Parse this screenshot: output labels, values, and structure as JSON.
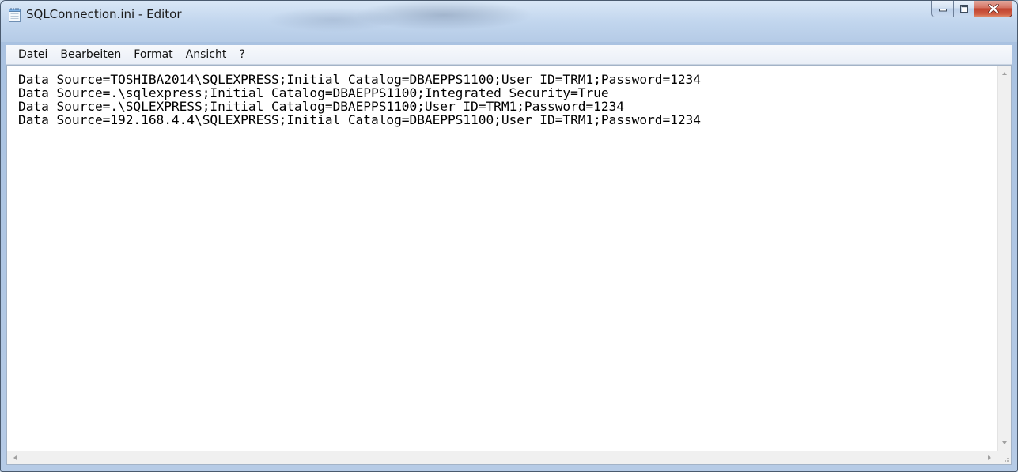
{
  "window": {
    "title": "SQLConnection.ini - Editor"
  },
  "menu": {
    "items": [
      {
        "label": "Datei"
      },
      {
        "label": "Bearbeiten"
      },
      {
        "label": "Format"
      },
      {
        "label": "Ansicht"
      },
      {
        "label": "?"
      }
    ]
  },
  "editor": {
    "lines": [
      "Data Source=TOSHIBA2014\\SQLEXPRESS;Initial Catalog=DBAEPPS1100;User ID=TRM1;Password=1234",
      "Data Source=.\\sqlexpress;Initial Catalog=DBAEPPS1100;Integrated Security=True",
      "Data Source=.\\SQLEXPRESS;Initial Catalog=DBAEPPS1100;User ID=TRM1;Password=1234",
      "Data Source=192.168.4.4\\SQLEXPRESS;Initial Catalog=DBAEPPS1100;User ID=TRM1;Password=1234"
    ]
  },
  "icons": {
    "app": "notepad-icon",
    "minimize": "minimize-icon",
    "maximize": "maximize-icon",
    "close": "close-icon"
  },
  "colors": {
    "close_button": "#c0432f",
    "frame": "#b7cde8"
  }
}
